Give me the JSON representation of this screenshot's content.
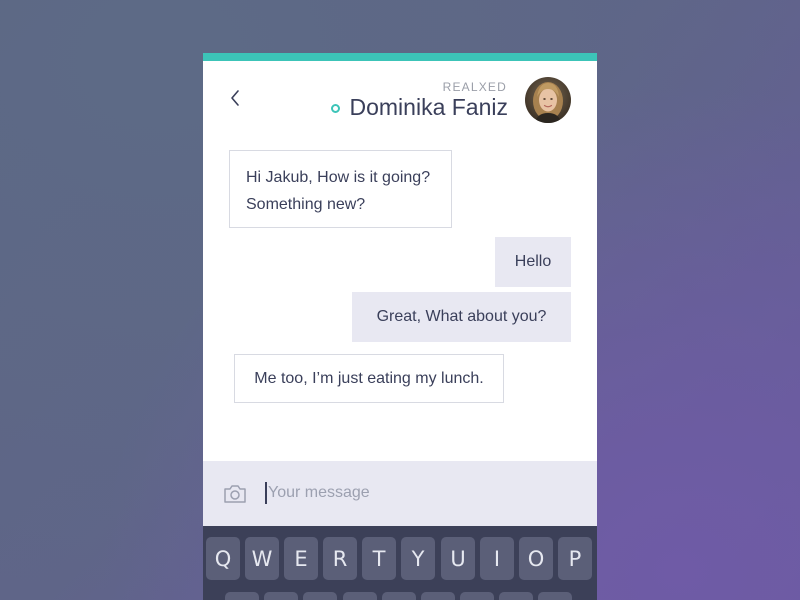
{
  "contact": {
    "status": "REALXED",
    "name": "Dominika Faniz"
  },
  "messages": [
    {
      "direction": "incoming",
      "lines": [
        "Hi Jakub, How is it going?",
        "Something new?"
      ]
    },
    {
      "direction": "outgoing",
      "text": "Hello"
    },
    {
      "direction": "outgoing",
      "text": "Great, What about you?"
    },
    {
      "direction": "incoming",
      "text": "Me too, I’m just eating my lunch."
    }
  ],
  "compose": {
    "placeholder": "Your message",
    "camera_icon": "camera-icon"
  },
  "keyboard": {
    "row1": [
      "Q",
      "W",
      "E",
      "R",
      "T",
      "Y",
      "U",
      "I",
      "O",
      "P"
    ]
  },
  "colors": {
    "accent": "#3cc4b8",
    "text": "#3a3f5a",
    "outgoing_bubble": "#e8e8f2",
    "keyboard": "#3c4058",
    "key": "#5b5f78"
  },
  "icons": [
    "back-chevron-icon",
    "online-status-icon",
    "camera-icon"
  ]
}
